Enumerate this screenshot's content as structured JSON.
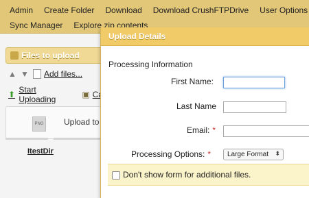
{
  "menu": {
    "row1": [
      "Admin",
      "Create Folder",
      "Download",
      "Download CrushFTPDrive",
      "User Options"
    ],
    "row2": [
      "Sync Manager",
      "Explore zip contents"
    ]
  },
  "left_panel": {
    "files_header": "Files to upload",
    "add_files": "Add files...",
    "start_uploading": "Start Uploading",
    "cancel_label": "Ca",
    "upload_to": "Upload to",
    "thumb_label": "PNG",
    "dir_name": "ItestDir"
  },
  "modal": {
    "title": "Upload Details",
    "section": "Processing Information",
    "first_name_label": "First Name:",
    "first_name_value": "",
    "last_name_label": "Last Name",
    "last_name_value": "",
    "email_label": "Email:",
    "email_value": "",
    "processing_label": "Processing Options:",
    "processing_selected": "Large Format",
    "required_mark": "*",
    "notice_text": "Don't show form for additional files."
  }
}
